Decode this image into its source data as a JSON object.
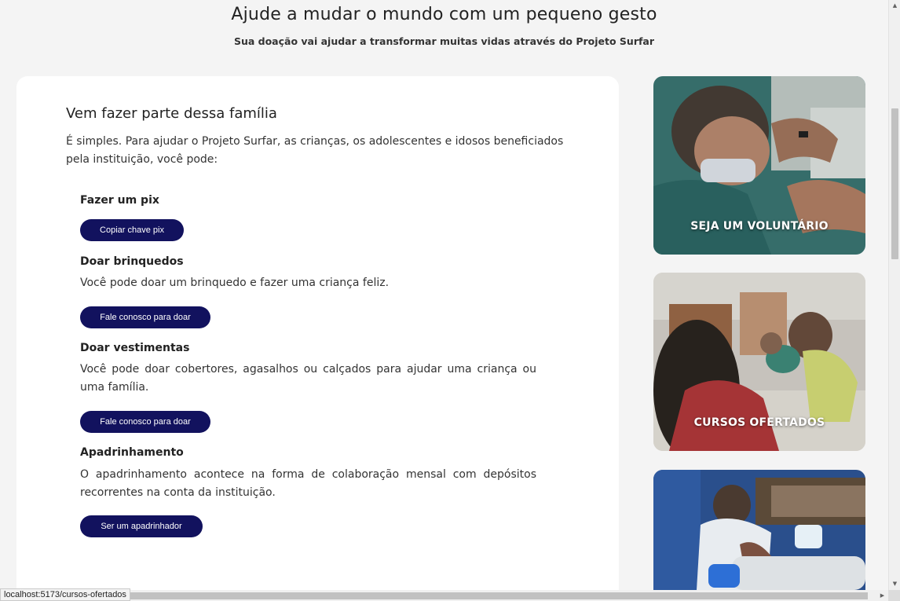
{
  "hero": {
    "title": "Ajude a mudar o mundo com um pequeno gesto",
    "subtitle": "Sua doação vai ajudar a transformar muitas vidas através do Projeto Surfar"
  },
  "main": {
    "title": "Vem fazer parte dessa família",
    "intro": "É simples. Para ajudar o Projeto Surfar, as crianças, os adolescentes e idosos beneficiados pela instituição, você pode:",
    "items": [
      {
        "title": "Fazer um pix",
        "button": "Copiar chave pix"
      },
      {
        "title": "Doar brinquedos",
        "text": "Você pode doar um brinquedo e fazer uma criança feliz.",
        "button": "Fale conosco para doar"
      },
      {
        "title": "Doar vestimentas",
        "text": "Você pode doar cobertores, agasalhos ou calçados para ajudar uma criança ou uma família.",
        "button": "Fale conosco para doar"
      },
      {
        "title": "Apadrinhamento",
        "text": "O apadrinhamento acontece na forma de colaboração mensal com depósitos recorrentes na conta da instituição.",
        "button": "Ser um apadrinhador"
      }
    ]
  },
  "sidebar": {
    "cards": [
      {
        "label": "SEJA UM VOLUNTÁRIO"
      },
      {
        "label": "CURSOS OFERTADOS"
      },
      {
        "label": ""
      }
    ]
  },
  "status": {
    "url": "localhost:5173/cursos-ofertados"
  },
  "colors": {
    "button": "#12125e",
    "card": "#ffffff",
    "background": "#f4f4f4"
  }
}
